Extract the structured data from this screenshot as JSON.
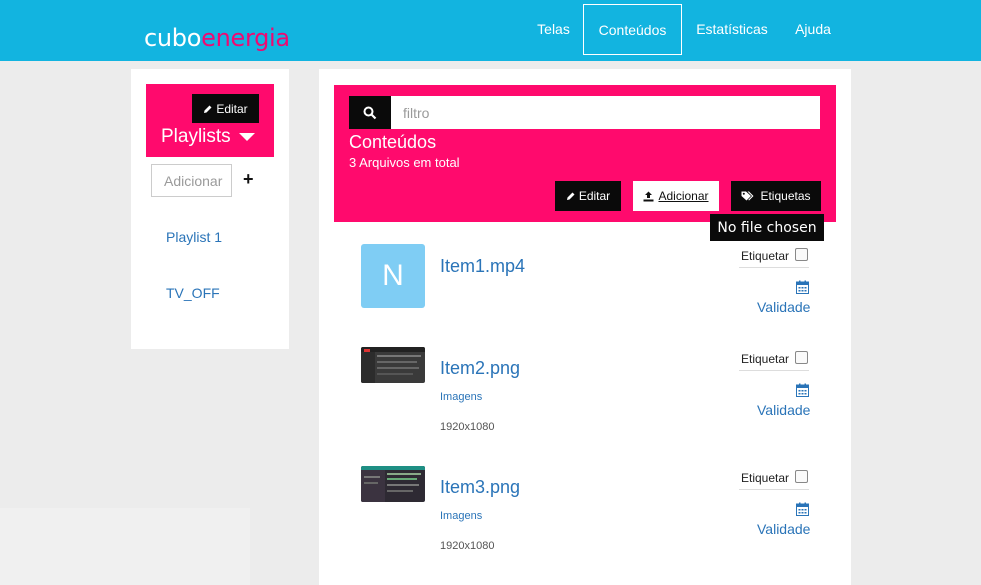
{
  "brand": {
    "part1": "cubo",
    "part2": "energia",
    "color_primary": "#12b4e0",
    "color_accent": "#ff0a6d"
  },
  "nav": {
    "items": [
      {
        "label": "Telas",
        "active": false
      },
      {
        "label": "Conteúdos",
        "active": true
      },
      {
        "label": "Estatísticas",
        "active": false
      },
      {
        "label": "Ajuda",
        "active": false
      }
    ]
  },
  "sidebar": {
    "edit_label": "Editar",
    "title": "Playlists",
    "add_placeholder": "Adicionar",
    "add_icon": "plus-icon",
    "items": [
      {
        "label": "Playlist 1"
      },
      {
        "label": "TV_OFF"
      }
    ]
  },
  "content": {
    "search_placeholder": "filtro",
    "title": "Conteúdos",
    "subtitle": "3 Arquivos em total",
    "edit_label": "Editar",
    "add_label": "Adicionar",
    "tags_label": "Etiquetas",
    "tooltip": "No file chosen"
  },
  "items": [
    {
      "name": "Item1.mp4",
      "thumb_letter": "N",
      "category": "",
      "resolution": "",
      "tag_label": "Etiquetar",
      "validity": "Validade"
    },
    {
      "name": "Item2.png",
      "thumb_letter": "",
      "category": "Imagens",
      "resolution": "1920x1080",
      "tag_label": "Etiquetar",
      "validity": "Validade"
    },
    {
      "name": "Item3.png",
      "thumb_letter": "",
      "category": "Imagens",
      "resolution": "1920x1080",
      "tag_label": "Etiquetar",
      "validity": "Validade"
    }
  ]
}
